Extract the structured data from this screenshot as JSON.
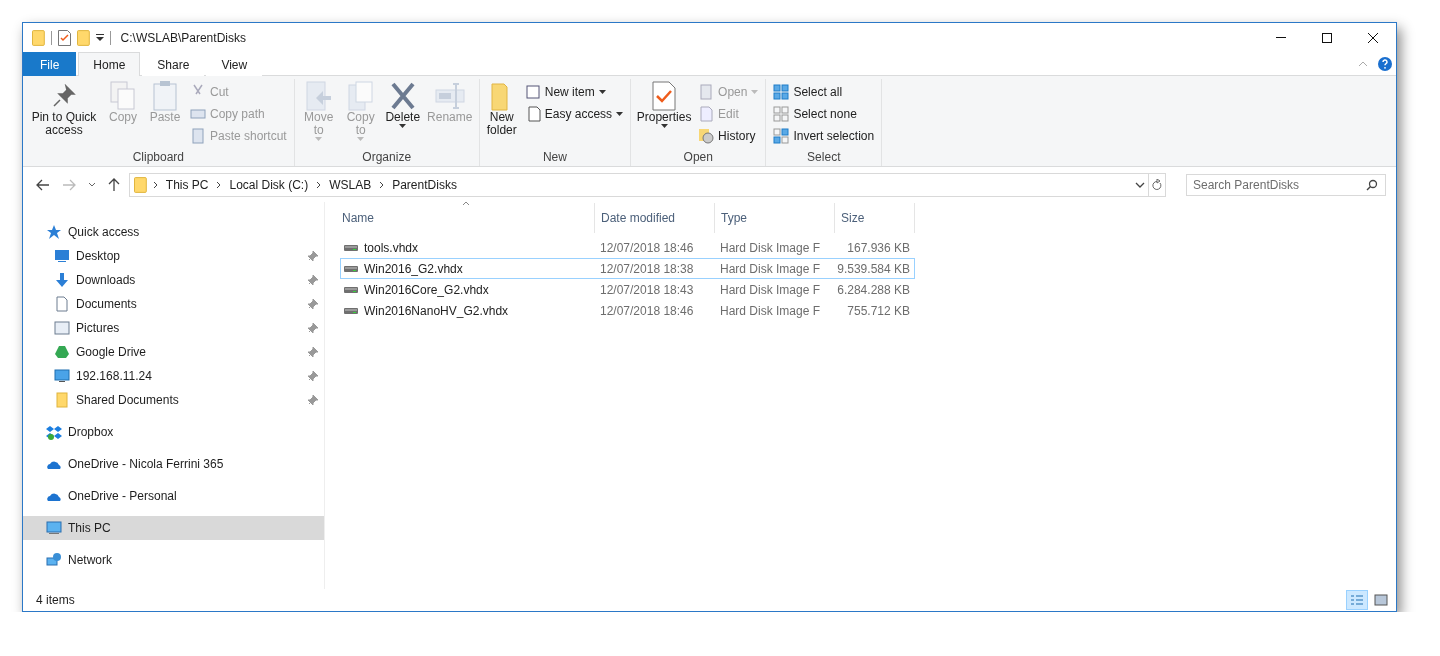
{
  "window": {
    "title": "C:\\WSLAB\\ParentDisks"
  },
  "tabs": [
    {
      "label": "File",
      "kind": "file",
      "selected": false
    },
    {
      "label": "Home",
      "kind": "tab",
      "selected": true
    },
    {
      "label": "Share",
      "kind": "tab",
      "selected": false
    },
    {
      "label": "View",
      "kind": "tab",
      "selected": false
    }
  ],
  "ribbon": {
    "groups": [
      {
        "label": "Clipboard",
        "commands": [
          {
            "label": "Pin to Quick access",
            "kind": "large",
            "disabled": false,
            "dropdown": false
          },
          {
            "label": "Copy",
            "kind": "large",
            "disabled": true,
            "dropdown": false
          },
          {
            "label": "Paste",
            "kind": "large",
            "disabled": true,
            "dropdown": false
          },
          {
            "label": "Cut",
            "kind": "small",
            "disabled": true,
            "dropdown": false
          },
          {
            "label": "Copy path",
            "kind": "small",
            "disabled": true,
            "dropdown": false
          },
          {
            "label": "Paste shortcut",
            "kind": "small",
            "disabled": true,
            "dropdown": false
          }
        ]
      },
      {
        "label": "Organize",
        "commands": [
          {
            "label": "Move to",
            "kind": "large",
            "disabled": true,
            "dropdown": true
          },
          {
            "label": "Copy to",
            "kind": "large",
            "disabled": true,
            "dropdown": true
          },
          {
            "label": "Delete",
            "kind": "large",
            "disabled": false,
            "dropdown": true
          },
          {
            "label": "Rename",
            "kind": "large",
            "disabled": true,
            "dropdown": false
          }
        ]
      },
      {
        "label": "New",
        "commands": [
          {
            "label": "New folder",
            "kind": "large",
            "disabled": false,
            "dropdown": false
          },
          {
            "label": "New item",
            "kind": "small",
            "disabled": false,
            "dropdown": true
          },
          {
            "label": "Easy access",
            "kind": "small",
            "disabled": false,
            "dropdown": true
          }
        ]
      },
      {
        "label": "Open",
        "commands": [
          {
            "label": "Properties",
            "kind": "large",
            "disabled": false,
            "dropdown": true
          },
          {
            "label": "Open",
            "kind": "small",
            "disabled": true,
            "dropdown": true
          },
          {
            "label": "Edit",
            "kind": "small",
            "disabled": true,
            "dropdown": false
          },
          {
            "label": "History",
            "kind": "small",
            "disabled": false,
            "dropdown": false
          }
        ]
      },
      {
        "label": "Select",
        "commands": [
          {
            "label": "Select all",
            "kind": "small",
            "disabled": false,
            "dropdown": false
          },
          {
            "label": "Select none",
            "kind": "small",
            "disabled": false,
            "dropdown": false
          },
          {
            "label": "Invert selection",
            "kind": "small",
            "disabled": false,
            "dropdown": false
          }
        ]
      }
    ]
  },
  "address": {
    "crumbs": [
      "This PC",
      "Local Disk (C:)",
      "WSLAB",
      "ParentDisks"
    ]
  },
  "search": {
    "placeholder": "Search ParentDisks"
  },
  "sidebar": {
    "items": [
      {
        "label": "Quick access",
        "selected": false,
        "children": [
          {
            "label": "Desktop",
            "pinned": true,
            "selected": false
          },
          {
            "label": "Downloads",
            "pinned": true,
            "selected": false
          },
          {
            "label": "Documents",
            "pinned": true,
            "selected": false
          },
          {
            "label": "Pictures",
            "pinned": true,
            "selected": false
          },
          {
            "label": "Google Drive",
            "pinned": true,
            "selected": false
          },
          {
            "label": "192.168.11.24",
            "pinned": true,
            "selected": false
          },
          {
            "label": "Shared Documents",
            "pinned": true,
            "selected": false
          }
        ]
      },
      {
        "label": "Dropbox",
        "selected": false
      },
      {
        "label": "OneDrive - Nicola Ferrini 365",
        "selected": false
      },
      {
        "label": "OneDrive - Personal",
        "selected": false
      },
      {
        "label": "This PC",
        "selected": true
      },
      {
        "label": "Network",
        "selected": false
      }
    ]
  },
  "table": {
    "columns": [
      {
        "label": "Name",
        "sorted": true
      },
      {
        "label": "Date modified",
        "sorted": false
      },
      {
        "label": "Type",
        "sorted": false
      },
      {
        "label": "Size",
        "sorted": false
      }
    ],
    "rows": [
      {
        "cells": [
          "tools.vhdx",
          "12/07/2018 18:46",
          "Hard Disk Image F",
          "167.936 KB"
        ],
        "focused": false
      },
      {
        "cells": [
          "Win2016_G2.vhdx",
          "12/07/2018 18:38",
          "Hard Disk Image F",
          "9.539.584 KB"
        ],
        "focused": true
      },
      {
        "cells": [
          "Win2016Core_G2.vhdx",
          "12/07/2018 18:43",
          "Hard Disk Image F",
          "6.284.288 KB"
        ],
        "focused": false
      },
      {
        "cells": [
          "Win2016NanoHV_G2.vhdx",
          "12/07/2018 18:46",
          "Hard Disk Image F",
          "755.712 KB"
        ],
        "focused": false
      }
    ]
  },
  "status_bar": {
    "text": "4 items",
    "views": [
      {
        "selected": true
      },
      {
        "selected": false
      }
    ]
  }
}
